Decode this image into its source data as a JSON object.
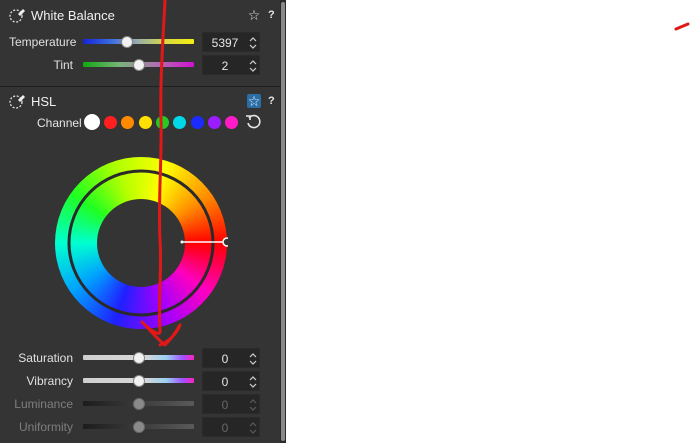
{
  "white_balance": {
    "title": "White Balance",
    "star_icon": "star-outline-icon",
    "help": "?",
    "temperature": {
      "label": "Temperature",
      "value": "5397",
      "level": 0.4
    },
    "tint": {
      "label": "Tint",
      "value": "2",
      "level": 0.5
    }
  },
  "hsl": {
    "title": "HSL",
    "star_icon": "star-active-icon",
    "help": "?",
    "channel_label": "Channel",
    "channels": [
      {
        "name": "master",
        "color": "#ffffff"
      },
      {
        "name": "red",
        "color": "#ff1f1f"
      },
      {
        "name": "orange",
        "color": "#ff8a00"
      },
      {
        "name": "yellow",
        "color": "#ffe000"
      },
      {
        "name": "green",
        "color": "#22cc22"
      },
      {
        "name": "aqua",
        "color": "#00d8e8"
      },
      {
        "name": "blue",
        "color": "#1c2cff"
      },
      {
        "name": "purple",
        "color": "#9a1cff"
      },
      {
        "name": "magenta",
        "color": "#ff1cc8"
      }
    ],
    "saturation": {
      "label": "Saturation",
      "value": "0",
      "level": 0.5
    },
    "vibrancy": {
      "label": "Vibrancy",
      "value": "0",
      "level": 0.5
    },
    "luminance": {
      "label": "Luminance",
      "value": "0",
      "level": 0.5
    },
    "uniformity": {
      "label": "Uniformity",
      "value": "0",
      "level": 0.5
    }
  },
  "colors": {
    "panel_bg": "#343434",
    "accent": "#2b6ea6",
    "annotation": "#e01818"
  }
}
